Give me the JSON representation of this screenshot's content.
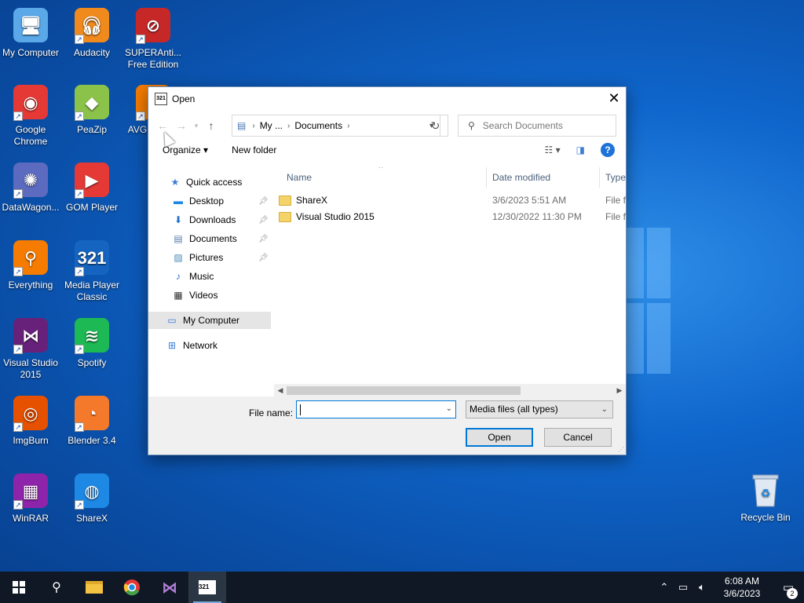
{
  "desktop": {
    "icons": [
      {
        "label": "My Computer",
        "icon": "computer-icon",
        "color": "#5aa8e8"
      },
      {
        "label": "Audacity",
        "icon": "audacity-icon",
        "color": "#f08a1d"
      },
      {
        "label": "SUPERAnti... Free Edition",
        "icon": "superantispyware-icon",
        "color": "#c62828"
      },
      {
        "label": "Google Chrome",
        "icon": "chrome-icon",
        "color": "#e53935"
      },
      {
        "label": "PeaZip",
        "icon": "peazip-icon",
        "color": "#8bc34a"
      },
      {
        "label": "AVG A... F...",
        "icon": "avg-icon",
        "color": "#f57c00"
      },
      {
        "label": "DataWagon...",
        "icon": "datawagon-icon",
        "color": "#5c6bc0"
      },
      {
        "label": "GOM Player",
        "icon": "gom-player-icon",
        "color": "#e53935"
      },
      {
        "label": "Everything",
        "icon": "everything-icon",
        "color": "#f57c00"
      },
      {
        "label": "Media Player Classic",
        "icon": "media-player-classic-icon",
        "color": "#1565c0"
      },
      {
        "label": "Visual Studio 2015",
        "icon": "visual-studio-icon",
        "color": "#68217a"
      },
      {
        "label": "Spotify",
        "icon": "spotify-icon",
        "color": "#1db954"
      },
      {
        "label": "ImgBurn",
        "icon": "imgburn-icon",
        "color": "#e65100"
      },
      {
        "label": "Blender 3.4",
        "icon": "blender-icon",
        "color": "#f5792a"
      },
      {
        "label": "WinRAR",
        "icon": "winrar-icon",
        "color": "#8e24aa"
      },
      {
        "label": "ShareX",
        "icon": "sharex-icon",
        "color": "#1e88e5"
      }
    ],
    "recycle_bin": {
      "label": "Recycle Bin",
      "icon": "recycle-bin-icon"
    }
  },
  "dialog": {
    "title": "Open",
    "close_glyph": "✕",
    "nav": {
      "back": "←",
      "forward": "→",
      "up": "↑",
      "refresh": "↻"
    },
    "breadcrumb": [
      "My ...",
      "Documents"
    ],
    "search_placeholder": "Search Documents",
    "toolbar": {
      "organize": "Organize ▾",
      "new_folder": "New folder",
      "help": "?"
    },
    "nav_pane": {
      "quick_access": "Quick access",
      "items": [
        {
          "label": "Desktop",
          "icon": "desktop-icon",
          "pinned": true
        },
        {
          "label": "Downloads",
          "icon": "downloads-icon",
          "pinned": true
        },
        {
          "label": "Documents",
          "icon": "documents-icon",
          "pinned": true
        },
        {
          "label": "Pictures",
          "icon": "pictures-icon",
          "pinned": true
        },
        {
          "label": "Music",
          "icon": "music-icon",
          "pinned": false
        },
        {
          "label": "Videos",
          "icon": "videos-icon",
          "pinned": false
        }
      ],
      "my_computer": "My Computer",
      "network": "Network"
    },
    "columns": {
      "name": "Name",
      "date_modified": "Date modified",
      "type": "Type"
    },
    "files": [
      {
        "name": "ShareX",
        "date": "3/6/2023 5:51 AM",
        "type": "File fo"
      },
      {
        "name": "Visual Studio 2015",
        "date": "12/30/2022 11:30 PM",
        "type": "File fo"
      }
    ],
    "footer": {
      "file_name_label": "File name:",
      "file_name_value": "",
      "filter": "Media files (all types)",
      "open": "Open",
      "cancel": "Cancel"
    }
  },
  "taskbar": {
    "clock_time": "6:08 AM",
    "clock_date": "3/6/2023",
    "notification_count": "2"
  }
}
